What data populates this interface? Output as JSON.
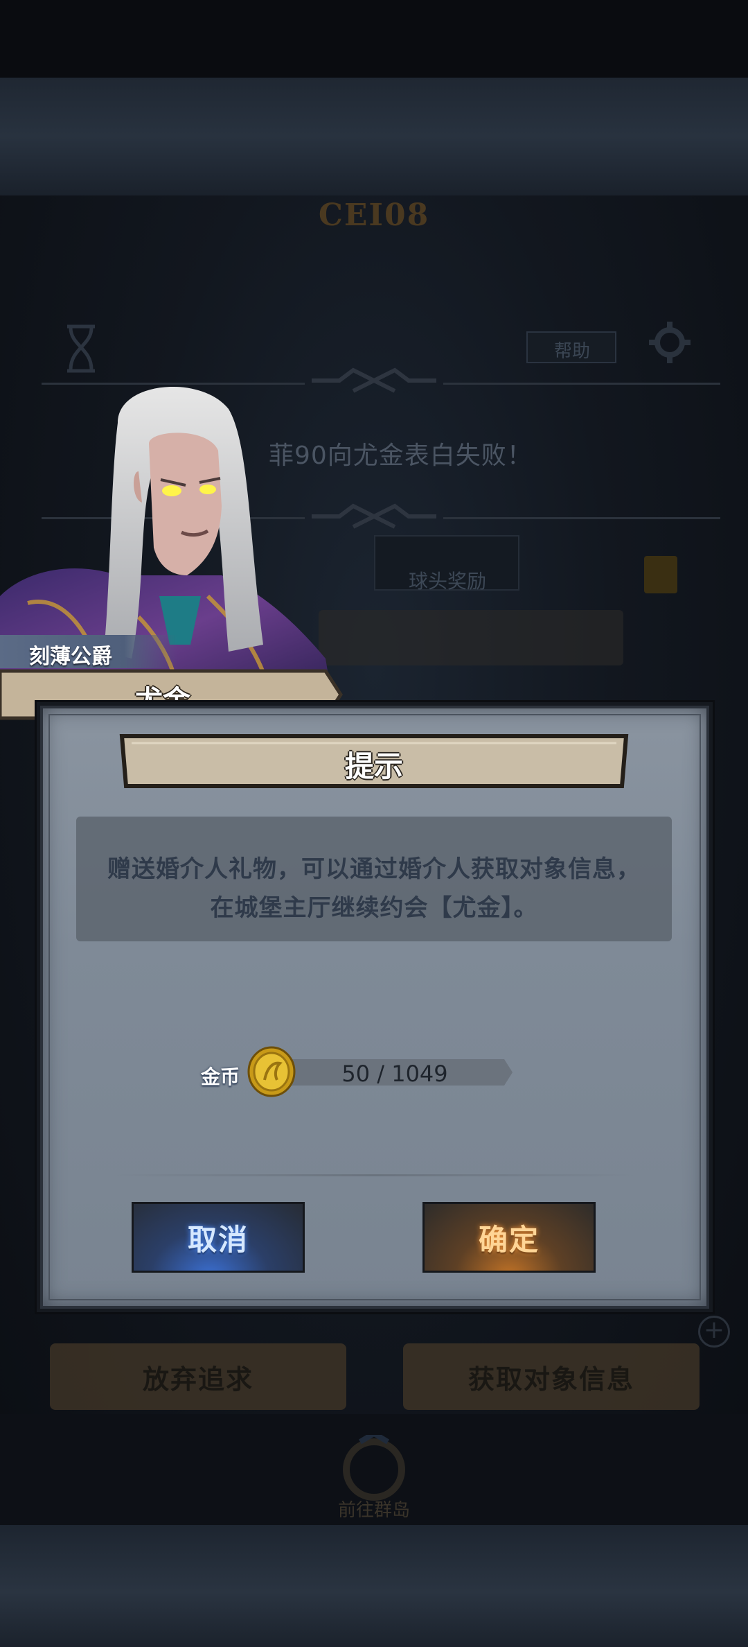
{
  "background": {
    "faded_title": "CEI08",
    "faded_tag": "帮助",
    "faded_message": "菲90向尤金表白失败！",
    "faded_panel_label": "球头奖励",
    "faded_buttons": {
      "give_up": "放弃追求",
      "get_info": "获取对象信息"
    },
    "faded_goto": "前往群岛"
  },
  "character": {
    "title": "刻薄公爵",
    "name": "尤金"
  },
  "dialog": {
    "title": "提示",
    "message_line_1": "赠送婚介人礼物，可以通过婚介人获取对象信息，",
    "message_line_2": "在城堡主厅继续约会【尤金】。",
    "currency": {
      "label": "金币",
      "icon": "gold-coin-icon",
      "value": "50 / 1049"
    },
    "cancel_label": "取消",
    "confirm_label": "确定"
  },
  "colors": {
    "dialog_bg": "#838d99",
    "cancel_glow": "#3b6fd2",
    "confirm_glow": "#c27326"
  }
}
